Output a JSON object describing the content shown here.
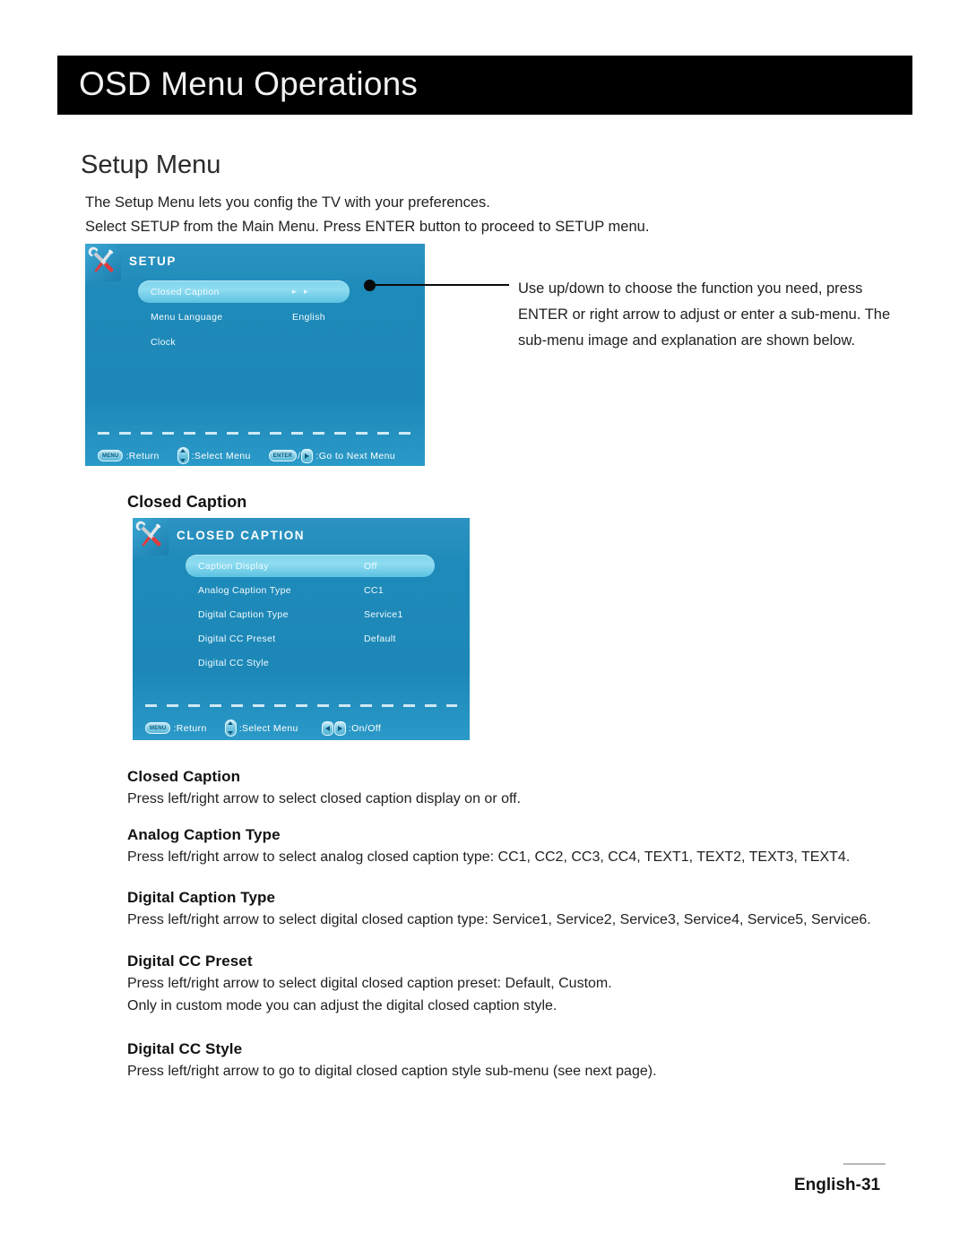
{
  "page": {
    "banner_title": "OSD Menu Operations",
    "section_title": "Setup Menu",
    "intro_line_1": "The Setup Menu lets you config the TV with your preferences.",
    "intro_line_2": "Select SETUP from the Main Menu. Press ENTER button to proceed to SETUP menu.",
    "footer_page": "English-31"
  },
  "callout": {
    "text": "Use up/down to choose the function you need, press ENTER or right arrow to adjust or enter a sub-menu. The sub-menu image and explanation are shown below."
  },
  "setup_osd": {
    "icon": "tools-icon",
    "title": "SETUP",
    "rows": [
      {
        "label": "Closed Caption",
        "value": "",
        "arrows": "▸ ▸",
        "selected": true
      },
      {
        "label": "Menu Language",
        "value": "English",
        "arrows": "",
        "selected": false
      },
      {
        "label": "Clock",
        "value": "",
        "arrows": "",
        "selected": false
      }
    ],
    "footer": [
      {
        "key": "MENU",
        "key_type": "label",
        "text": ":Return"
      },
      {
        "key": "",
        "key_type": "updown",
        "text": ":Select Menu"
      },
      {
        "key": "ENTER",
        "key_type": "enter-right",
        "text": ":Go to Next Menu"
      }
    ]
  },
  "cc_heading": "Closed Caption",
  "cc_osd": {
    "icon": "tools-icon",
    "title": "CLOSED CAPTION",
    "rows": [
      {
        "label": "Caption Display",
        "value": "Off",
        "selected": true
      },
      {
        "label": "Analog Caption Type",
        "value": "CC1",
        "selected": false
      },
      {
        "label": "Digital Caption Type",
        "value": "Service1",
        "selected": false
      },
      {
        "label": "Digital CC Preset",
        "value": "Default",
        "selected": false
      },
      {
        "label": "Digital CC Style",
        "value": "",
        "selected": false
      }
    ],
    "footer": [
      {
        "key": "MENU",
        "key_type": "label",
        "text": ":Return"
      },
      {
        "key": "",
        "key_type": "updown",
        "text": ":Select Menu"
      },
      {
        "key": "",
        "key_type": "leftright",
        "text": ":On/Off"
      }
    ]
  },
  "descriptions": [
    {
      "heading": "Closed Caption",
      "lines": [
        "Press left/right arrow to select closed caption display on or off."
      ]
    },
    {
      "heading": "Analog Caption Type",
      "lines": [
        "Press left/right arrow to select analog closed caption type: CC1, CC2, CC3, CC4, TEXT1, TEXT2, TEXT3, TEXT4."
      ]
    },
    {
      "heading": "Digital Caption Type",
      "lines": [
        "Press left/right arrow to select digital closed caption type: Service1, Service2, Service3, Service4, Service5, Service6."
      ]
    },
    {
      "heading": "Digital CC Preset",
      "lines": [
        "Press left/right arrow to select digital closed caption preset: Default, Custom.",
        "Only in custom mode you can adjust the digital closed caption style."
      ]
    },
    {
      "heading": "Digital CC Style",
      "lines": [
        "Press left/right arrow to go to digital closed caption style sub-menu (see next page)."
      ]
    }
  ],
  "colors": {
    "osd_blue": "#1e8ab9",
    "osd_highlight": "#8fdcf0",
    "banner_black": "#000000",
    "text": "#1f1f1f"
  }
}
